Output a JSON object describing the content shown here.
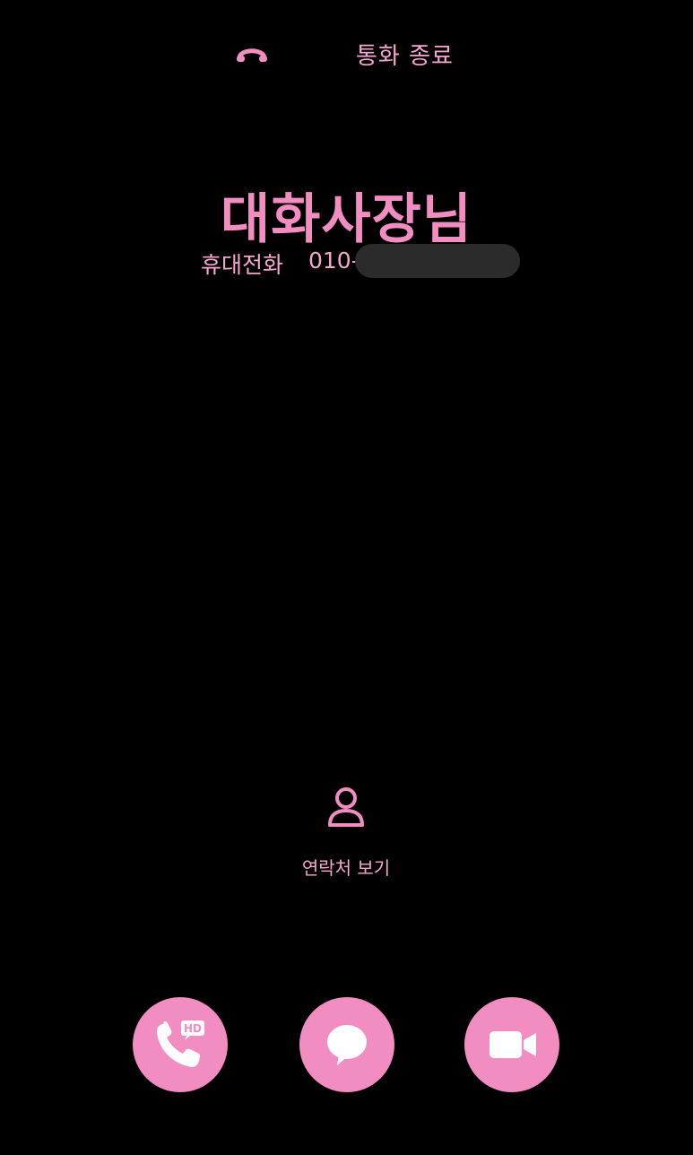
{
  "status": {
    "text": "통화 종료",
    "icon": "call-end-icon"
  },
  "caller": {
    "name": "대화사장님",
    "label": "휴대전화",
    "number_prefix": "010-"
  },
  "contact_action": {
    "label": "연락처 보기",
    "icon": "person-icon"
  },
  "actions": [
    {
      "name": "hd-voice-call",
      "icon": "phone-hd-icon",
      "badge": "HD"
    },
    {
      "name": "message",
      "icon": "chat-bubble-icon"
    },
    {
      "name": "video-call",
      "icon": "video-camera-icon"
    }
  ],
  "colors": {
    "background": "#000000",
    "accent": "#f28dc1",
    "text": "#f4a7cf",
    "redaction": "#2b2b2b"
  }
}
